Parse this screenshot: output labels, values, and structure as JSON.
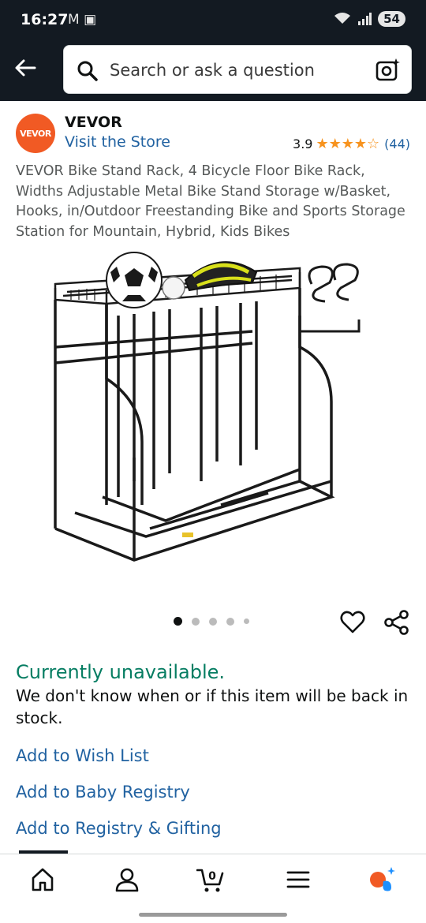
{
  "status_bar": {
    "time": "16:27",
    "notifications": "M ▣",
    "signal": "◥ .ıl",
    "battery": "54"
  },
  "header": {
    "back_icon": "arrow-left-icon",
    "search_placeholder": "Search or ask a question",
    "lens_icon": "camera-lens-icon"
  },
  "brand": {
    "logo_text": "VEVOR",
    "name": "VEVOR",
    "visit_store": "Visit the Store",
    "rating": "3.9",
    "stars": "★★★★☆",
    "review_count": "(44)",
    "star_color": "#f7931e"
  },
  "product": {
    "title": "VEVOR Bike Stand Rack, 4 Bicycle Floor Bike Rack, Widths Adjustable Metal Bike Stand Storage w/Basket, Hooks, in/Outdoor Freestanding Bike and Sports Storage Station for Mountain, Hybrid, Kids Bikes",
    "image_count": 5,
    "current_image": 1
  },
  "availability": {
    "status": "Currently unavailable.",
    "message": "We don't know when or if this item will be back in stock.",
    "status_color": "#067d62"
  },
  "links": {
    "wish_list": "Add to Wish List",
    "baby_registry": "Add to Baby Registry",
    "registry_gifting": "Add to Registry & Gifting"
  },
  "bottom_nav": {
    "items": [
      "home-icon",
      "account-icon",
      "cart-icon",
      "menu-icon",
      "rufus-assistant-icon"
    ],
    "cart_count": "0"
  },
  "colors": {
    "header_bg": "#131a22",
    "link": "#2162a1",
    "accent": "#f15a24"
  }
}
